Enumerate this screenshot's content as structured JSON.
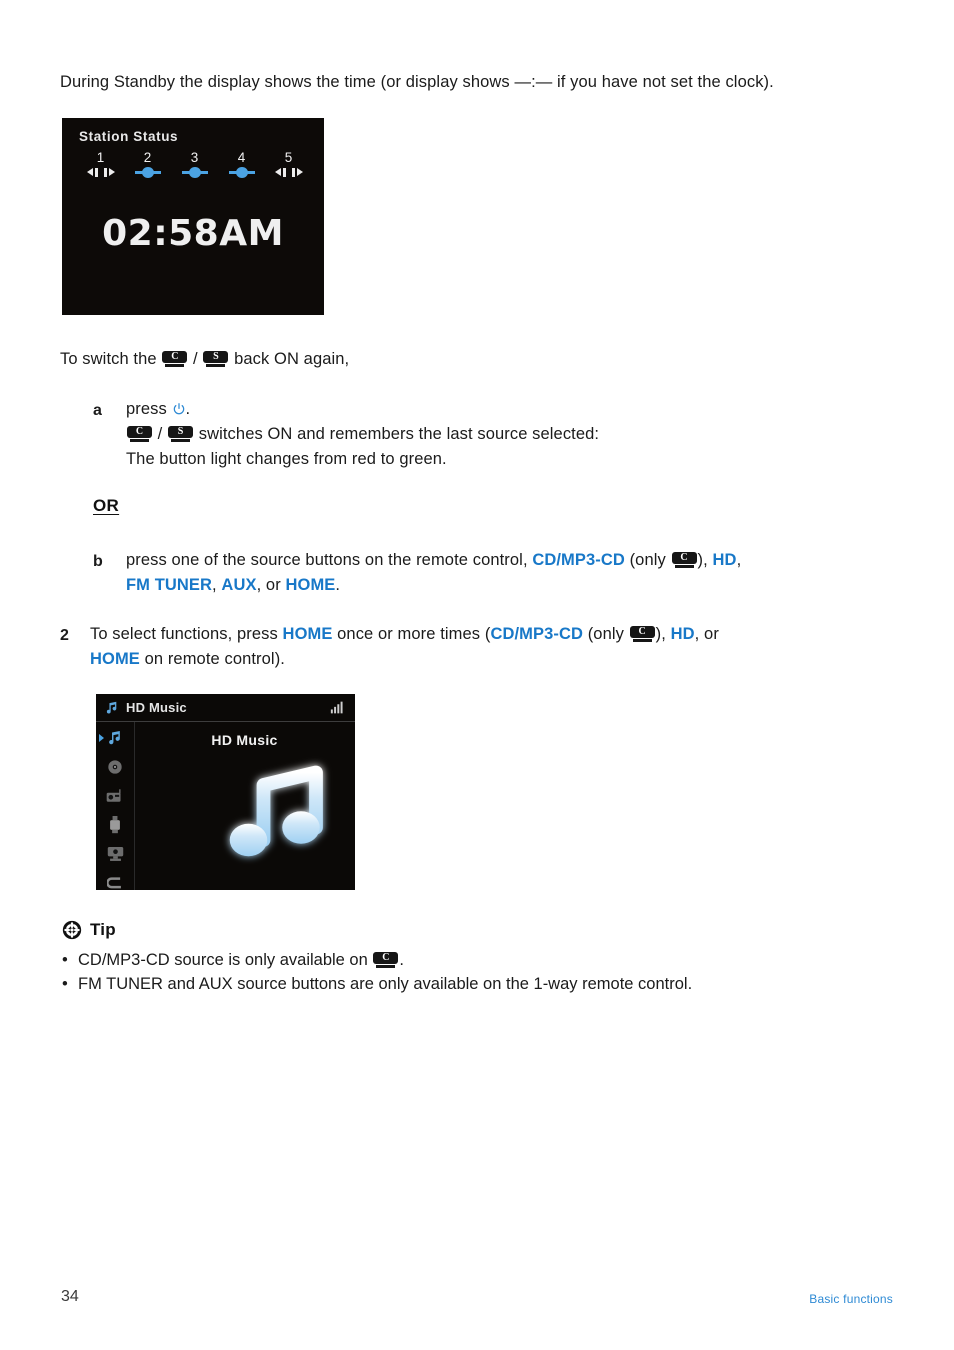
{
  "document": {
    "intro_paragraph": "During Standby the display shows the time (or display shows —:— if you have not set the clock).",
    "switch_on_line_pre": "To switch the ",
    "switch_on_line_sep": " / ",
    "switch_on_line_post": " back ON again,",
    "or_label": "OR",
    "page_number": "34",
    "footer_section": "Basic functions"
  },
  "clock_display": {
    "title": "Station Status",
    "time": "02:58AM",
    "stations": [
      {
        "number": "1",
        "state": "disconnected",
        "icon": "plug-disconnected-icon"
      },
      {
        "number": "2",
        "state": "connected",
        "icon": "plug-connected-icon"
      },
      {
        "number": "3",
        "state": "connected",
        "icon": "plug-connected-icon"
      },
      {
        "number": "4",
        "state": "connected",
        "icon": "plug-connected-icon"
      },
      {
        "number": "5",
        "state": "disconnected",
        "icon": "plug-disconnected-icon"
      }
    ]
  },
  "badges": {
    "center_letter": "C",
    "station_letter": "S",
    "center_name": "center-device-icon",
    "station_name": "station-device-icon"
  },
  "step_a": {
    "marker": "a",
    "text_pre": "press ",
    "power_icon": "power-icon",
    "text_post": ".",
    "line2_mid": " switches ON and remembers the last source selected:",
    "line3": "The button light changes from red to green."
  },
  "step_b": {
    "marker": "b",
    "text_1": "press one of the source buttons on the remote control, ",
    "src_cd": "CD/MP3-CD",
    "only_open": " (only ",
    "only_close": "), ",
    "src_hd": "HD",
    "comma": ", ",
    "src_fm": "FM TUNER",
    "src_aux": "AUX",
    "or_text": ", or ",
    "src_home": "HOME",
    "period": "."
  },
  "step_2": {
    "marker": "2",
    "text_1": "To select functions, press ",
    "src_home": "HOME",
    "text_2": " once or more times (",
    "src_cd": "CD/MP3-CD",
    "only_open": " (only ",
    "only_close": "), ",
    "src_hd": "HD",
    "text_3": ", or ",
    "src_home2": "HOME",
    "text_4": " on remote control)."
  },
  "hd_music_display": {
    "header_title": "HD Music",
    "header_icon": "music-note-icon",
    "signal_icon": "signal-strength-icon",
    "main_label": "HD Music",
    "main_icon": "music-note-large-icon",
    "sidebar": [
      {
        "icon": "music-note-icon",
        "selected": true
      },
      {
        "icon": "cd-disc-icon",
        "selected": false
      },
      {
        "icon": "radio-tuner-icon",
        "selected": false
      },
      {
        "icon": "usb-icon",
        "selected": false
      },
      {
        "icon": "aux-input-icon",
        "selected": false
      },
      {
        "icon": "return-arrow-icon",
        "selected": false
      }
    ]
  },
  "tip": {
    "heading": "Tip",
    "icon": "tip-asterisk-icon",
    "item1_pre": "CD/MP3-CD source is only available on ",
    "item1_post": ".",
    "item2": "FM TUNER and AUX source buttons are only available on the 1-way remote control."
  },
  "colors": {
    "accent_blue": "#1878c8",
    "link_blue": "#2e8ad4",
    "screen_black": "#0d0a08",
    "screen_blue": "#4ba3e3"
  }
}
